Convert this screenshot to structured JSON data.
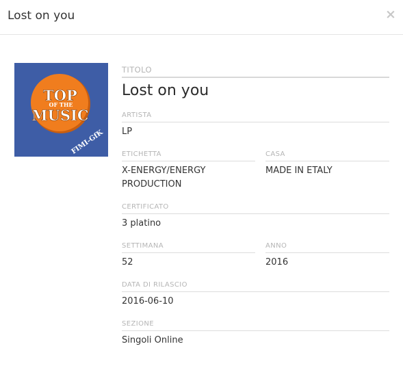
{
  "modal": {
    "title": "Lost on you",
    "close_label": "×"
  },
  "cover": {
    "icon": "top-of-the-music-logo",
    "line1": "TOP",
    "line2": "OF THE",
    "line3": "MUSIC",
    "badge": "FIMI-GfK",
    "bg_color": "#3e5da6",
    "circle_color": "#f07d1e"
  },
  "fields": {
    "titolo": {
      "label": "TITOLO",
      "value": "Lost on you"
    },
    "artista": {
      "label": "ARTISTA",
      "value": "LP"
    },
    "etichetta": {
      "label": "ETICHETTA",
      "value": "X-ENERGY/ENERGY PRODUCTION"
    },
    "casa": {
      "label": "CASA",
      "value": "MADE IN ETALY"
    },
    "certificato": {
      "label": "CERTIFICATO",
      "value": "3 platino"
    },
    "settimana": {
      "label": "SETTIMANA",
      "value": "52"
    },
    "anno": {
      "label": "ANNO",
      "value": "2016"
    },
    "data_rilascio": {
      "label": "DATA DI RILASCIO",
      "value": "2016-06-10"
    },
    "sezione": {
      "label": "SEZIONE",
      "value": "Singoli Online"
    }
  }
}
